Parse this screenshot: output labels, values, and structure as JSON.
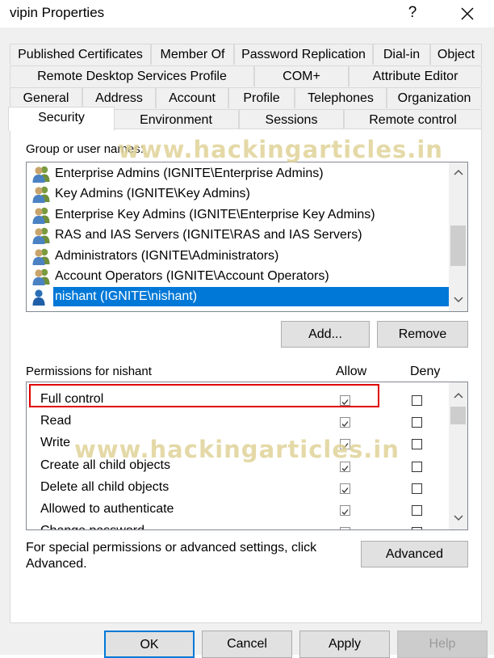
{
  "window": {
    "title": "vipin Properties",
    "help_label": "?"
  },
  "tabs_row1": [
    "Published Certificates",
    "Member Of",
    "Password Replication",
    "Dial-in",
    "Object"
  ],
  "tabs_row2": [
    "Remote Desktop Services Profile",
    "COM+",
    "Attribute Editor"
  ],
  "tabs_row3": [
    "General",
    "Address",
    "Account",
    "Profile",
    "Telephones",
    "Organization"
  ],
  "tabs_row4": [
    "Security",
    "Environment",
    "Sessions",
    "Remote control"
  ],
  "active_tab": "Security",
  "security": {
    "group_label": "Group or user names:",
    "users": [
      "Enterprise Admins (IGNITE\\Enterprise Admins)",
      "Key Admins (IGNITE\\Key Admins)",
      "Enterprise Key Admins (IGNITE\\Enterprise Key Admins)",
      "RAS and IAS Servers (IGNITE\\RAS and IAS Servers)",
      "Administrators (IGNITE\\Administrators)",
      "Account Operators (IGNITE\\Account Operators)",
      "nishant (IGNITE\\nishant)"
    ],
    "selected_user": "nishant (IGNITE\\nishant)",
    "add_label": "Add...",
    "remove_label": "Remove",
    "permissions_label": "Permissions for nishant",
    "allow_label": "Allow",
    "deny_label": "Deny",
    "permissions": [
      {
        "name": "Full control",
        "allow": true,
        "deny": false
      },
      {
        "name": "Read",
        "allow": true,
        "deny": false
      },
      {
        "name": "Write",
        "allow": true,
        "deny": false
      },
      {
        "name": "Create all child objects",
        "allow": true,
        "deny": false
      },
      {
        "name": "Delete all child objects",
        "allow": true,
        "deny": false
      },
      {
        "name": "Allowed to authenticate",
        "allow": true,
        "deny": false
      },
      {
        "name": "Change password",
        "allow": true,
        "deny": false
      }
    ],
    "special_text_1": "For special permissions or advanced settings, click",
    "special_text_2": "Advanced.",
    "advanced_label": "Advanced"
  },
  "footer": {
    "ok": "OK",
    "cancel": "Cancel",
    "apply": "Apply",
    "help": "Help"
  },
  "watermark": "www.hackingarticles.in",
  "colors": {
    "selection": "#0078d7",
    "highlight_box": "#e00000",
    "watermark": "#cdb95f"
  }
}
